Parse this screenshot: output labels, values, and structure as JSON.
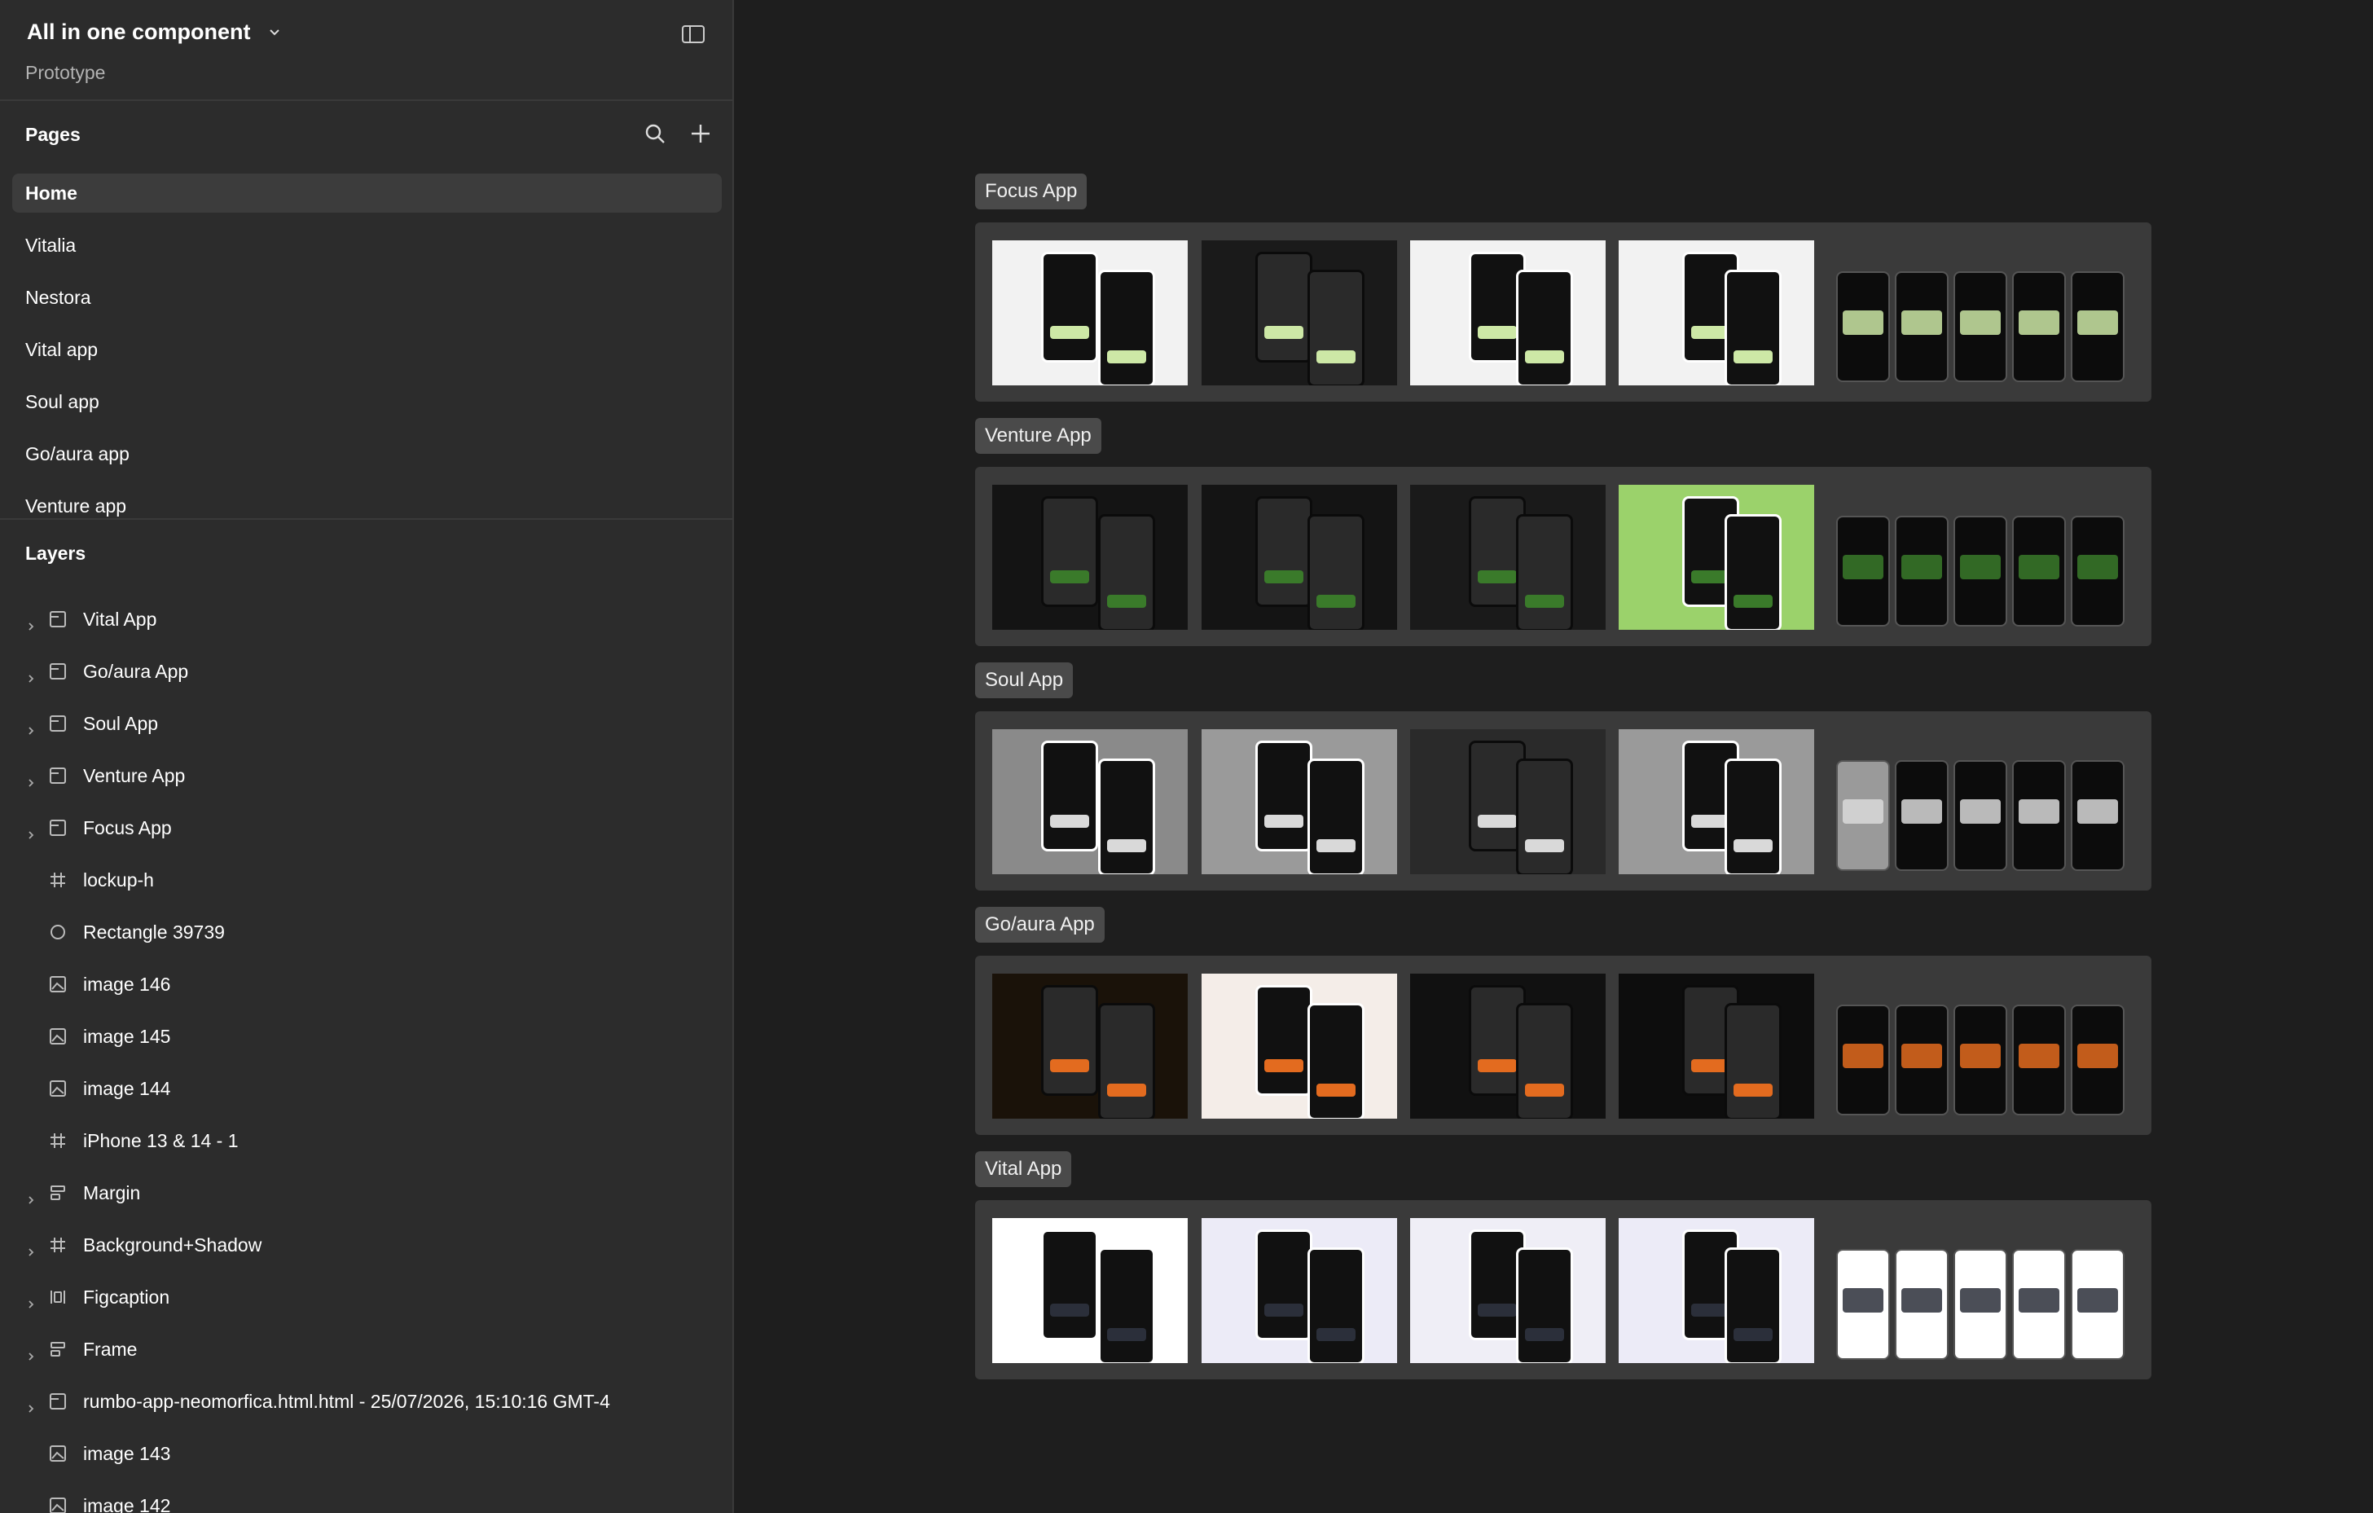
{
  "file": {
    "title": "All in one component",
    "subtitle": "Prototype"
  },
  "pages": {
    "title": "Pages",
    "items": [
      {
        "label": "Home",
        "active": true
      },
      {
        "label": "Vitalia"
      },
      {
        "label": "Nestora"
      },
      {
        "label": "Vital app"
      },
      {
        "label": "Soul app"
      },
      {
        "label": "Go/aura app"
      },
      {
        "label": "Venture app"
      }
    ]
  },
  "layers": {
    "title": "Layers",
    "items": [
      {
        "label": "Vital App",
        "icon": "section-icon",
        "expandable": true
      },
      {
        "label": "Go/aura App",
        "icon": "section-icon",
        "expandable": true
      },
      {
        "label": "Soul App",
        "icon": "section-icon",
        "expandable": true
      },
      {
        "label": "Venture App",
        "icon": "section-icon",
        "expandable": true
      },
      {
        "label": "Focus App",
        "icon": "section-icon",
        "expandable": true
      },
      {
        "label": "lockup-h",
        "icon": "frame-icon",
        "expandable": false
      },
      {
        "label": "Rectangle 39739",
        "icon": "ellipse-icon",
        "expandable": false
      },
      {
        "label": "image 146",
        "icon": "image-icon",
        "expandable": false
      },
      {
        "label": "image 145",
        "icon": "image-icon",
        "expandable": false
      },
      {
        "label": "image 144",
        "icon": "image-icon",
        "expandable": false
      },
      {
        "label": "iPhone 13 & 14 - 1",
        "icon": "frame-icon",
        "expandable": false
      },
      {
        "label": "Margin",
        "icon": "auto-layout-icon",
        "expandable": true
      },
      {
        "label": "Background+Shadow",
        "icon": "frame-icon",
        "expandable": true
      },
      {
        "label": "Figcaption",
        "icon": "columns-icon",
        "expandable": true
      },
      {
        "label": "Frame",
        "icon": "auto-layout-icon",
        "expandable": true
      },
      {
        "label": "rumbo-app-neomorfica.html.html - 25/07/2026, 15:10:16 GMT-4",
        "icon": "section-icon",
        "expandable": true
      },
      {
        "label": "image 143",
        "icon": "image-icon",
        "expandable": false
      },
      {
        "label": "image 142",
        "icon": "image-icon",
        "expandable": false
      }
    ]
  },
  "canvas": {
    "sections": [
      {
        "label": "Focus App",
        "theme": [
          "#f2f2f2",
          "#1a1a1a",
          "#f2f2f2",
          "#f2f2f2"
        ],
        "accent": "#cde8a6"
      },
      {
        "label": "Venture App",
        "theme": [
          "#141414",
          "#141414",
          "#1a1a1a",
          "#9bd26b"
        ],
        "accent": "#3a7a2a"
      },
      {
        "label": "Soul App",
        "theme": [
          "#8a8a8a",
          "#9a9a9a",
          "#2a2a2a",
          "#9a9a9a"
        ],
        "accent": "#d9d9d9"
      },
      {
        "label": "Go/aura App",
        "theme": [
          "#1a1209",
          "#f4ede8",
          "#111111",
          "#0d0d0d"
        ],
        "accent": "#e36b1f"
      },
      {
        "label": "Vital App",
        "theme": [
          "#ffffff",
          "#ecebf7",
          "#efeef6",
          "#ecebf7"
        ],
        "accent": "#2b2f3a"
      }
    ]
  }
}
